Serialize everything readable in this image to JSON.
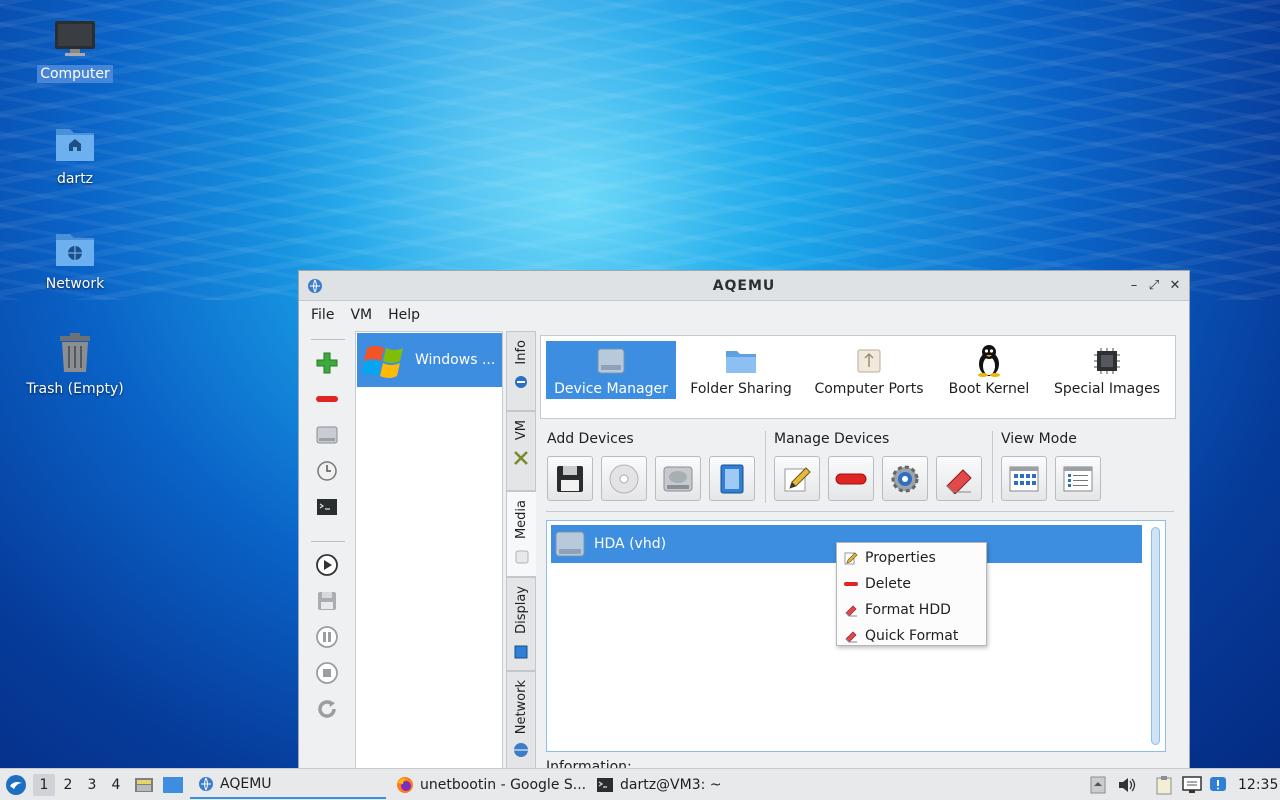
{
  "desktop": {
    "icons": [
      {
        "label": "Computer",
        "icon": "computer-icon"
      },
      {
        "label": "dartz",
        "icon": "home-folder-icon"
      },
      {
        "label": "Network",
        "icon": "network-folder-icon"
      },
      {
        "label": "Trash (Empty)",
        "icon": "trash-icon"
      }
    ]
  },
  "window": {
    "title": "AQEMU",
    "menu": [
      "File",
      "VM",
      "Help"
    ],
    "vm_list": [
      {
        "name": "Windows ...",
        "icon": "windows-xp-icon"
      }
    ],
    "side_tabs": [
      "Info",
      "VM",
      "Media",
      "Display",
      "Network"
    ],
    "top_tabs": [
      {
        "label": "Device Manager",
        "icon": "hdd-icon",
        "active": true
      },
      {
        "label": "Folder Sharing",
        "icon": "folder-icon"
      },
      {
        "label": "Computer Ports",
        "icon": "usb-icon"
      },
      {
        "label": "Boot Kernel",
        "icon": "tux-icon"
      },
      {
        "label": "Special Images",
        "icon": "chip-icon"
      }
    ],
    "groups": {
      "add_devices": "Add Devices",
      "manage_devices": "Manage Devices",
      "view_mode": "View Mode"
    },
    "devices": [
      {
        "label": "HDA (vhd)",
        "icon": "hdd-icon"
      }
    ],
    "information_label": "Information:",
    "context_menu": [
      {
        "label": "Properties",
        "icon": "pencil-icon"
      },
      {
        "label": "Delete",
        "icon": "remove-icon"
      },
      {
        "label": "Format HDD",
        "icon": "eraser-icon"
      },
      {
        "label": "Quick Format",
        "icon": "eraser-icon"
      }
    ]
  },
  "taskbar": {
    "workspaces": [
      "1",
      "2",
      "3",
      "4"
    ],
    "tasks": [
      {
        "label": "AQEMU",
        "icon": "aqemu-icon"
      },
      {
        "label": "unetbootin - Google S...",
        "icon": "firefox-icon"
      },
      {
        "label": "dartz@VM3: ~",
        "icon": "terminal-icon"
      }
    ],
    "clock": "12:35"
  },
  "colors": {
    "accent": "#3d8ee0",
    "taskbar": "#e7e9eb"
  }
}
